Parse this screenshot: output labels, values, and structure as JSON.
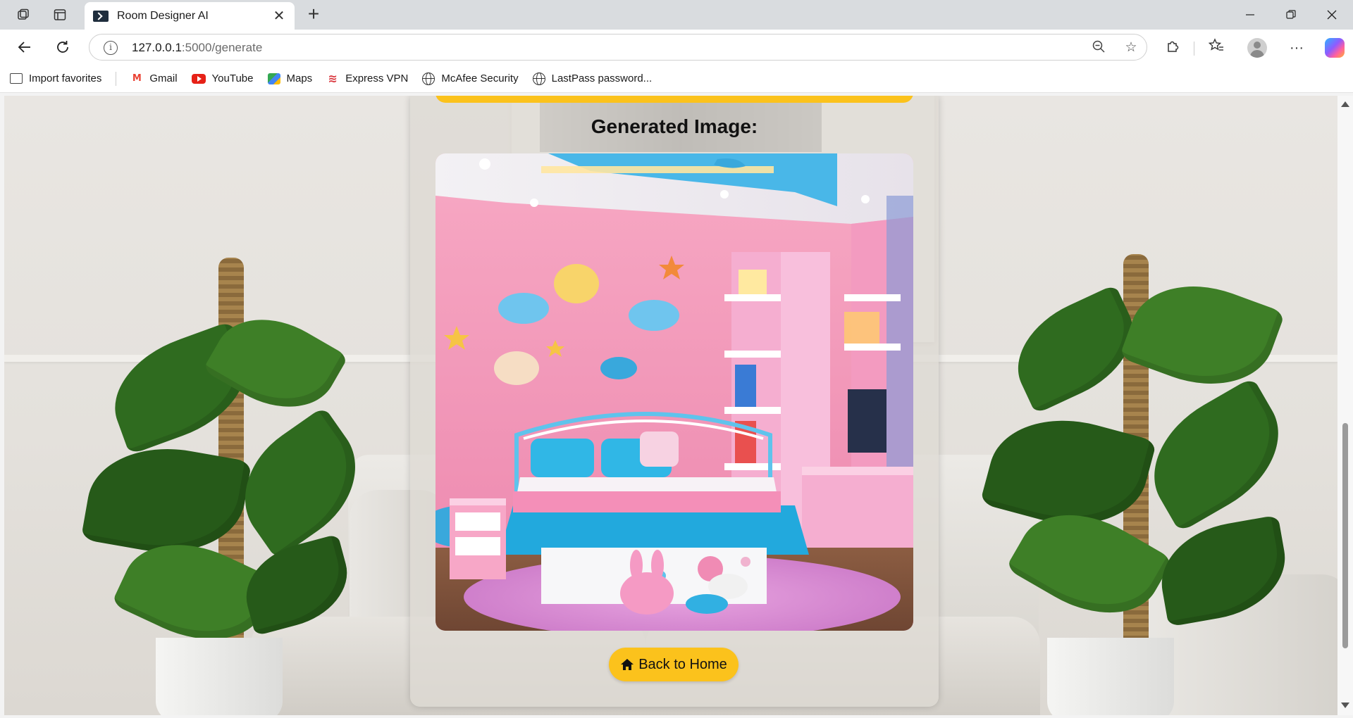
{
  "browser": {
    "tab_title": "Room Designer AI",
    "url_host": "127.0.0.1",
    "url_path": ":5000/generate",
    "favorites": [
      {
        "label": "Import favorites",
        "icon": "import-icon"
      },
      {
        "label": "Gmail",
        "icon": "gmail-icon"
      },
      {
        "label": "YouTube",
        "icon": "youtube-icon"
      },
      {
        "label": "Maps",
        "icon": "maps-icon"
      },
      {
        "label": "Express VPN",
        "icon": "expressvpn-icon"
      },
      {
        "label": "McAfee Security",
        "icon": "globe-icon"
      },
      {
        "label": "LastPass password...",
        "icon": "globe-icon"
      }
    ]
  },
  "page": {
    "heading": "Generated Image:",
    "back_button": "Back to Home",
    "accent_color": "#fbc21c"
  }
}
